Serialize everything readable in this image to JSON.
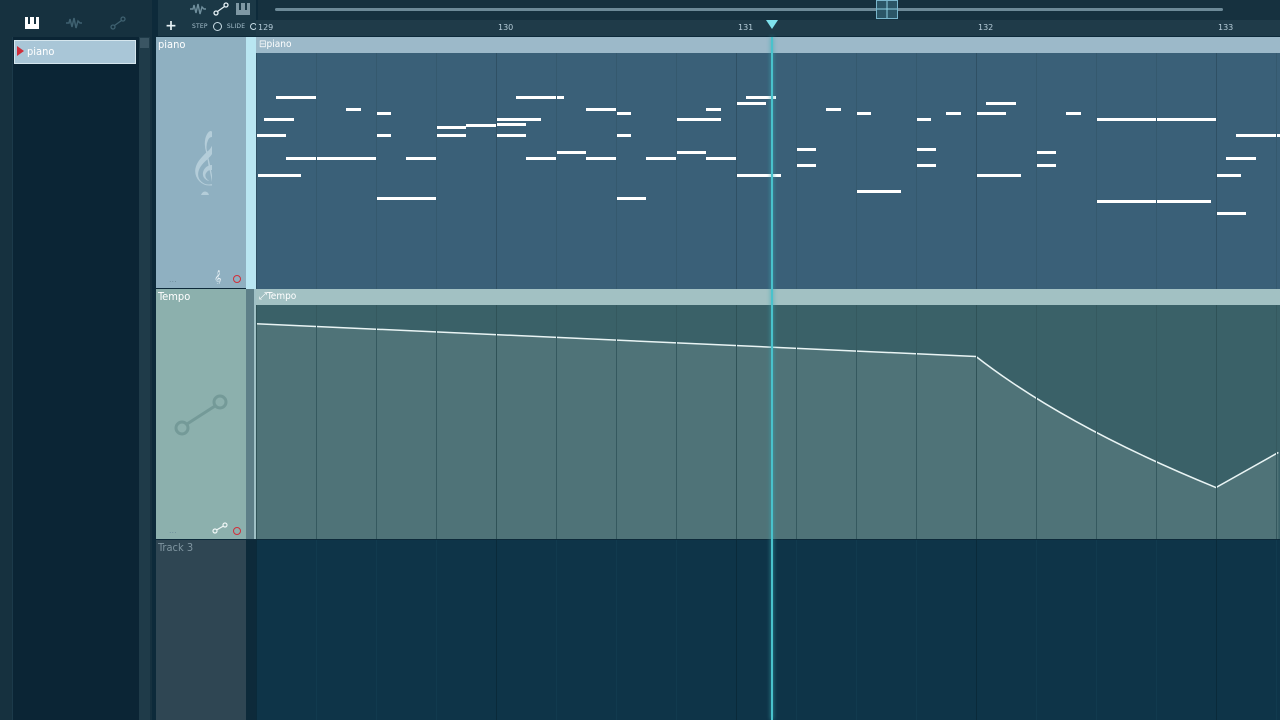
{
  "browser": {
    "tabs": [
      {
        "icon": "piano-roll-icon"
      },
      {
        "icon": "audio-clip-icon"
      },
      {
        "icon": "automation-icon"
      }
    ],
    "pattern_name": "piano"
  },
  "toolbar": {
    "add_label": "+",
    "step_label": "STEP",
    "slide_label": "SLIDE"
  },
  "ruler": {
    "bars": [
      "129",
      "130",
      "131",
      "132",
      "133"
    ],
    "playhead_bar": 131.15
  },
  "tracks": [
    {
      "name": "piano",
      "clip": "piano",
      "type": "pattern"
    },
    {
      "name": "Tempo",
      "clip": "Tempo",
      "type": "automation"
    },
    {
      "name": "Track 3",
      "clip": "",
      "type": "empty"
    }
  ],
  "tempo_curve": [
    {
      "bar": 129.0,
      "level": 0.92
    },
    {
      "bar": 132.0,
      "level": 0.78
    },
    {
      "bar": 133.0,
      "level": 0.22
    },
    {
      "bar": 133.26,
      "level": 0.37
    }
  ],
  "colors": {
    "piano_clip": "#3a6078",
    "tempo_clip": "#3a6168",
    "playhead": "#49c2cc",
    "notes": "#ffffff"
  }
}
